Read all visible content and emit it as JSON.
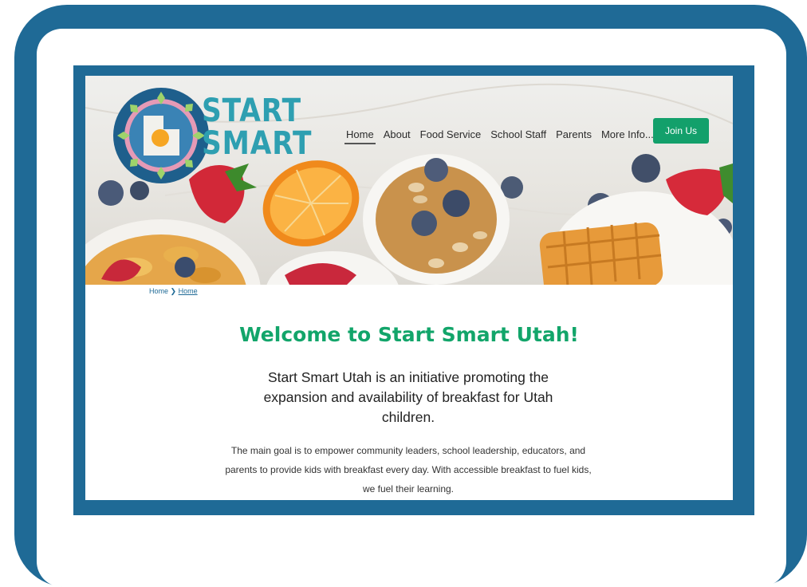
{
  "logo": {
    "line1": "START",
    "line2": "SMART"
  },
  "nav": {
    "items": [
      {
        "label": "Home",
        "active": true
      },
      {
        "label": "About",
        "active": false
      },
      {
        "label": "Food Service",
        "active": false
      },
      {
        "label": "School Staff",
        "active": false
      },
      {
        "label": "Parents",
        "active": false
      },
      {
        "label": "More Info...",
        "active": false
      }
    ],
    "join_label": "Join Us"
  },
  "breadcrumb": {
    "home": "Home",
    "separator": "❯",
    "current": "Home"
  },
  "content": {
    "title": "Welcome to Start Smart Utah!",
    "intro": "Start Smart Utah is an initiative promoting the expansion and availability of breakfast for Utah children.",
    "goal": "The main goal is to empower community leaders, school leadership, educators, and parents to provide kids with breakfast every day. With accessible breakfast to fuel kids, we fuel their learning."
  },
  "colors": {
    "frame": "#1f6a96",
    "brand_green": "#13a06b",
    "logo_teal": "#2e9fb1"
  }
}
